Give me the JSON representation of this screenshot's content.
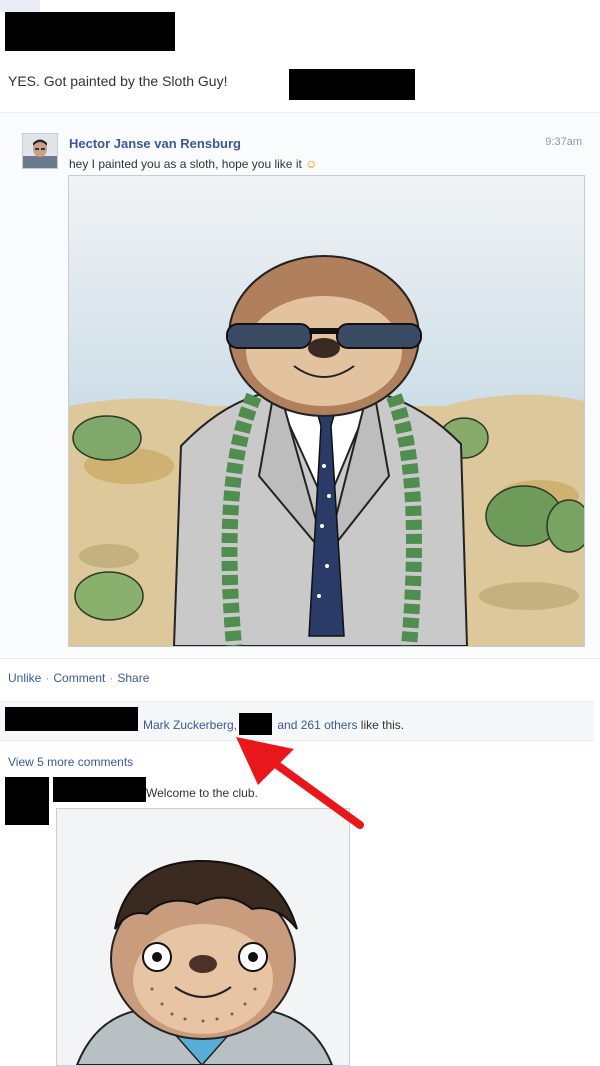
{
  "post": {
    "status_text": "YES. Got painted by the Sloth Guy!"
  },
  "shared_message": {
    "author": "Hector Janse van Rensburg",
    "text": "hey I painted you as a sloth, hope you like it",
    "emoji": "☺",
    "time": "9:37am"
  },
  "actions": {
    "unlike": "Unlike",
    "comment": "Comment",
    "share": "Share",
    "separator": "·"
  },
  "likes": {
    "name": "Mark Zuckerberg,",
    "others_link": "and 261 others",
    "suffix": "like this."
  },
  "comments": {
    "view_more": "View 5 more comments",
    "first_comment_text": "Welcome to the club."
  },
  "colors": {
    "link": "#3b5998",
    "arrow": "#e8171b",
    "redaction": "#000000"
  },
  "icons": [
    "profile-photo",
    "sloth-painting",
    "smiley-emoji",
    "red-arrow"
  ]
}
